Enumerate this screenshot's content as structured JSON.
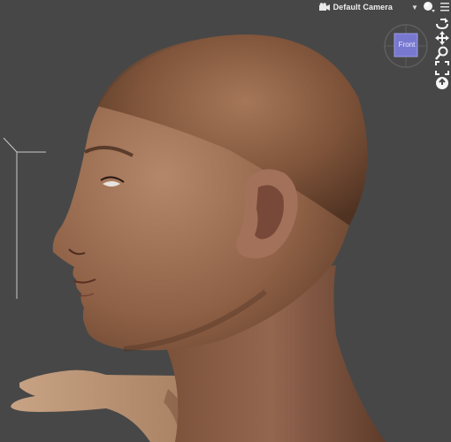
{
  "toolbar": {
    "camera_label": "Default Camera",
    "camera_dropdown_icon": "chevron-down-icon",
    "render_icon": "sphere-shading-icon",
    "menu_icon": "menu-icon"
  },
  "view_cube": {
    "face_label": "Front"
  },
  "navigation_tools": [
    {
      "name": "orbit",
      "icon": "orbit-icon"
    },
    {
      "name": "pan",
      "icon": "move-icon"
    },
    {
      "name": "zoom",
      "icon": "zoom-icon"
    },
    {
      "name": "frame",
      "icon": "frame-icon"
    },
    {
      "name": "reset",
      "icon": "reset-view-icon"
    }
  ],
  "colors": {
    "background": "#474747",
    "cube_face": "#7878d0",
    "skin": "#9a6c4f"
  }
}
